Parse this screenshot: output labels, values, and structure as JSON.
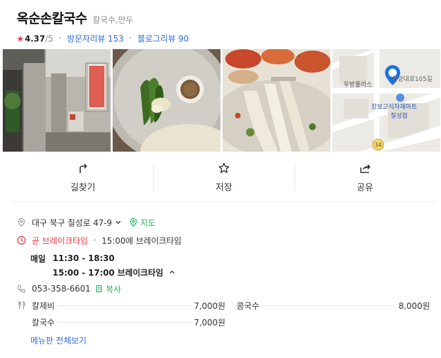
{
  "header": {
    "title": "옥순손칼국수",
    "category": "칼국수,만두",
    "rating": "4.37",
    "rating_max": "/5",
    "visitor_review_label": "방문자리뷰",
    "visitor_review_count": "153",
    "blog_review_label": "블로그리뷰",
    "blog_review_count": "90"
  },
  "photos": {
    "map_labels": {
      "road": "중앙대로105길",
      "place": "우방플라스",
      "store_line1": "장보고식자재마트",
      "store_line2": "칠성점",
      "route": "34"
    }
  },
  "actions": [
    {
      "label": "길찾기",
      "icon": "directions-icon"
    },
    {
      "label": "저장",
      "icon": "star-outline-icon"
    },
    {
      "label": "공유",
      "icon": "share-icon"
    }
  ],
  "info": {
    "address": "대구 북구 칠성로 47-9",
    "map_label": "지도",
    "hours_status": "곧 브레이크타임",
    "hours_note": "15:00에 브레이크타임",
    "hours": [
      {
        "day": "매일",
        "time": "11:30 - 18:30"
      },
      {
        "day": "",
        "time": "15:00 - 17:00 브레이크타임"
      }
    ],
    "phone": "053-358-6601",
    "copy_label": "복사",
    "menu": [
      {
        "name": "칼제비",
        "price": "7,000원"
      },
      {
        "name": "콩국수",
        "price": "8,000원"
      },
      {
        "name": "칼국수",
        "price": "7,000원"
      }
    ],
    "menu_more": "메뉴판 전체보기"
  },
  "colors": {
    "accent_blue": "#2d6bd9",
    "accent_green": "#1db35b",
    "accent_red": "#e9343f"
  }
}
